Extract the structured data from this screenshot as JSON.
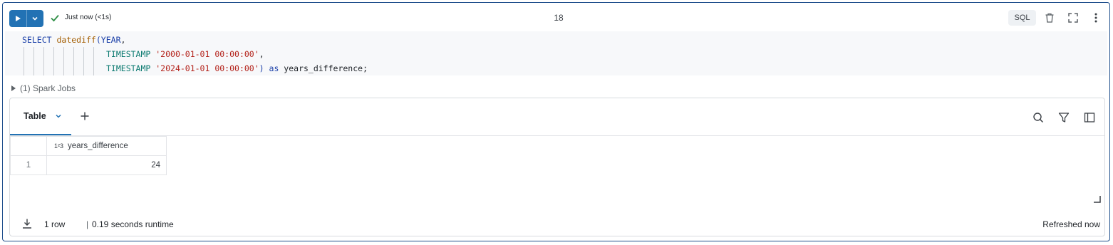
{
  "header": {
    "status_text": "Just now (<1s)",
    "cell_number": "18",
    "language": "SQL"
  },
  "code": {
    "line1": {
      "kw1": "SELECT ",
      "fn": "datediff",
      "p": "(",
      "arg": "YEAR",
      "c": ","
    },
    "line2": {
      "typ": "TIMESTAMP ",
      "str": "'2000-01-01 00:00:00'",
      "c": ","
    },
    "line3": {
      "typ": "TIMESTAMP ",
      "str": "'2024-01-01 00:00:00'",
      "p": ")",
      "as": " as ",
      "alias": "years_difference",
      "semi": ";"
    }
  },
  "spark_jobs": "(1) Spark Jobs",
  "results": {
    "tab_label": "Table",
    "column": {
      "type_glyph": "1²3",
      "name": "years_difference"
    },
    "rows": [
      {
        "index": "1",
        "value": "24"
      }
    ]
  },
  "footer": {
    "row_count": "1 row",
    "separator": "|",
    "runtime": "0.19 seconds runtime",
    "refreshed": "Refreshed now"
  },
  "colors": {
    "accent": "#2272b4",
    "border": "#1f4e8c"
  },
  "icons": [
    "play-icon",
    "chevron-down-icon",
    "check-icon",
    "trash-icon",
    "expand-icon",
    "more-vertical-icon",
    "caret-right-icon",
    "plus-icon",
    "search-icon",
    "filter-icon",
    "sidebar-icon",
    "download-icon",
    "resize-icon"
  ]
}
